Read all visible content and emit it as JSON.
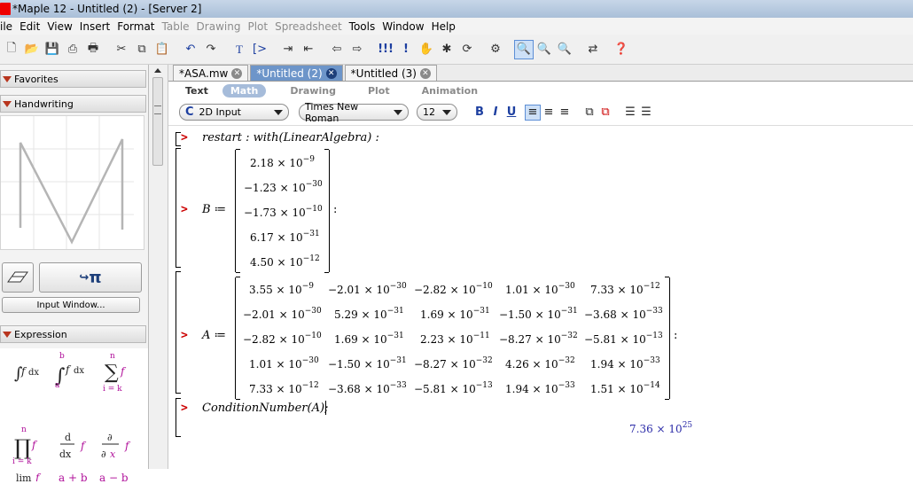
{
  "window": {
    "title": "*Maple 12 - Untitled (2) - [Server 2]"
  },
  "menu": [
    {
      "label": "File",
      "enabled": true
    },
    {
      "label": "Edit",
      "enabled": true
    },
    {
      "label": "View",
      "enabled": true
    },
    {
      "label": "Insert",
      "enabled": true
    },
    {
      "label": "Format",
      "enabled": true
    },
    {
      "label": "Table",
      "enabled": false
    },
    {
      "label": "Drawing",
      "enabled": false
    },
    {
      "label": "Plot",
      "enabled": false
    },
    {
      "label": "Spreadsheet",
      "enabled": false
    },
    {
      "label": "Tools",
      "enabled": true
    },
    {
      "label": "Window",
      "enabled": true
    },
    {
      "label": "Help",
      "enabled": true
    }
  ],
  "menu_file_visible": "ile",
  "palettes": {
    "favorites": "Favorites",
    "handwriting": "Handwriting",
    "input_window_button": "Input Window...",
    "pi_label": "π",
    "expression": "Expression",
    "expr_items": [
      "∫f dx",
      "∫f dx",
      "∑f",
      "∏f",
      "d/dx f",
      "∂/∂x f",
      "lim f",
      "a+b",
      "a−b"
    ],
    "expr_bounds": {
      "b": "b",
      "a": "a",
      "n": "n",
      "i_k": "i = k",
      "x": "x"
    }
  },
  "tabs": [
    {
      "label": "*ASA.mw",
      "active": false
    },
    {
      "label": "*Untitled (2)",
      "active": true
    },
    {
      "label": "*Untitled (3)",
      "active": false
    }
  ],
  "modes": {
    "text": "Text",
    "math": "Math",
    "drawing": "Drawing",
    "plot": "Plot",
    "animation": "Animation"
  },
  "format": {
    "style": "2D Input",
    "style_icon": "C",
    "font": "Times New Roman",
    "size": "12",
    "bold": "B",
    "italic": "I",
    "underline": "U"
  },
  "worksheet": {
    "line1": "restart : with(LinearAlgebra) :",
    "B_assign": "B ≔",
    "A_assign": "A ≔",
    "colon": ":",
    "B_vector": [
      {
        "m": "2.18",
        "e": "−9"
      },
      {
        "m": "−1.23",
        "e": "−30"
      },
      {
        "m": "−1.73",
        "e": "−10"
      },
      {
        "m": "6.17",
        "e": "−31"
      },
      {
        "m": "4.50",
        "e": "−12"
      }
    ],
    "A_matrix": [
      [
        {
          "m": "3.55",
          "e": "−9"
        },
        {
          "m": "−2.01",
          "e": "−30"
        },
        {
          "m": "−2.82",
          "e": "−10"
        },
        {
          "m": "1.01",
          "e": "−30"
        },
        {
          "m": "7.33",
          "e": "−12"
        }
      ],
      [
        {
          "m": "−2.01",
          "e": "−30"
        },
        {
          "m": "5.29",
          "e": "−31"
        },
        {
          "m": "1.69",
          "e": "−31"
        },
        {
          "m": "−1.50",
          "e": "−31"
        },
        {
          "m": "−3.68",
          "e": "−33"
        }
      ],
      [
        {
          "m": "−2.82",
          "e": "−10"
        },
        {
          "m": "1.69",
          "e": "−31"
        },
        {
          "m": "2.23",
          "e": "−11"
        },
        {
          "m": "−8.27",
          "e": "−32"
        },
        {
          "m": "−5.81",
          "e": "−13"
        }
      ],
      [
        {
          "m": "1.01",
          "e": "−30"
        },
        {
          "m": "−1.50",
          "e": "−31"
        },
        {
          "m": "−8.27",
          "e": "−32"
        },
        {
          "m": "4.26",
          "e": "−32"
        },
        {
          "m": "1.94",
          "e": "−33"
        }
      ],
      [
        {
          "m": "7.33",
          "e": "−12"
        },
        {
          "m": "−3.68",
          "e": "−33"
        },
        {
          "m": "−5.81",
          "e": "−13"
        },
        {
          "m": "1.94",
          "e": "−33"
        },
        {
          "m": "1.51",
          "e": "−14"
        }
      ]
    ],
    "times": "× 10",
    "line_cond": "ConditionNumber(A);",
    "result": {
      "m": "7.36",
      "e": "25"
    }
  },
  "colors": {
    "prompt": "#cc0000",
    "result": "#2b2ba8",
    "active_tab": "#6d95c9"
  }
}
